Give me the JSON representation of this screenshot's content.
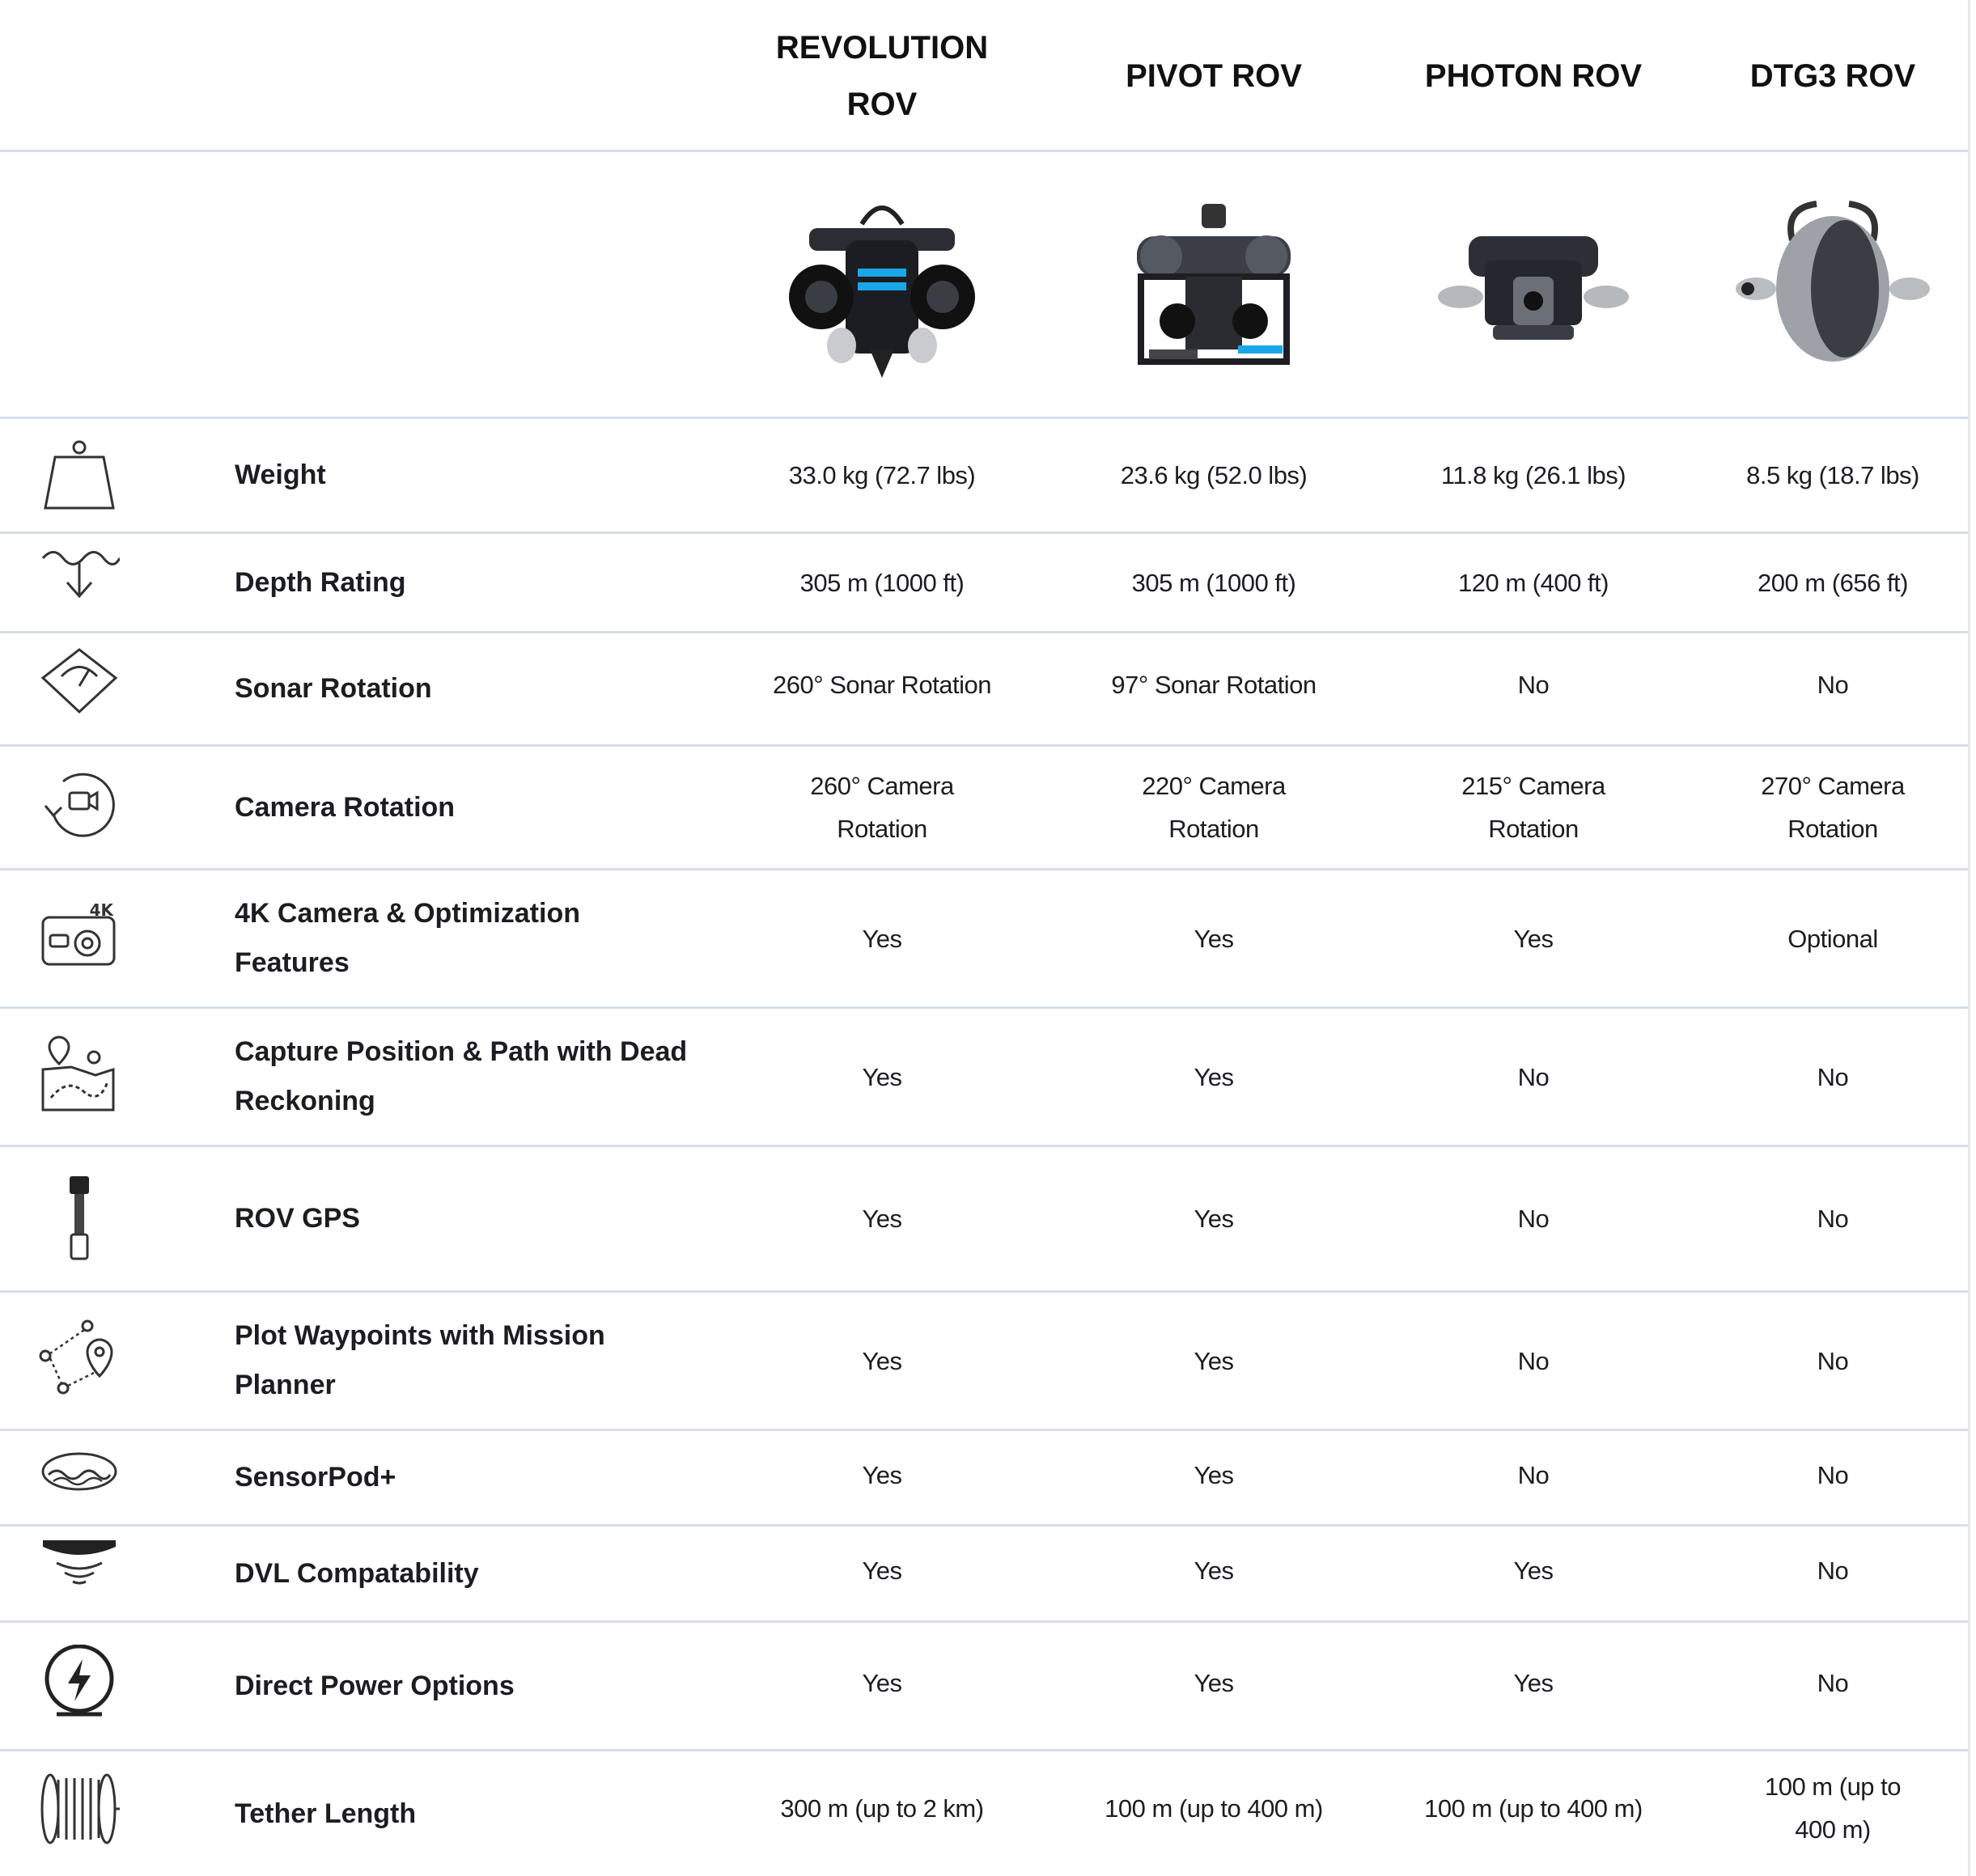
{
  "columns": [
    {
      "header": "REVOLUTION ROV",
      "image_alt": "revolution-rov"
    },
    {
      "header": "PIVOT ROV",
      "image_alt": "pivot-rov"
    },
    {
      "header": "PHOTON ROV",
      "image_alt": "photon-rov"
    },
    {
      "header": "DTG3 ROV",
      "image_alt": "dtg3-rov"
    }
  ],
  "rows": [
    {
      "label": "Weight",
      "icon": "weight-icon",
      "values": [
        "33.0 kg (72.7 lbs)",
        "23.6 kg (52.0 lbs)",
        "11.8 kg (26.1 lbs)",
        "8.5 kg (18.7 lbs)"
      ]
    },
    {
      "label": "Depth Rating",
      "icon": "depth-icon",
      "values": [
        "305 m (1000 ft)",
        "305 m (1000 ft)",
        "120 m (400 ft)",
        "200 m (656 ft)"
      ]
    },
    {
      "label": "Sonar Rotation",
      "icon": "sonar-icon",
      "values": [
        "260° Sonar Rotation",
        "97° Sonar Rotation",
        "No",
        "No"
      ]
    },
    {
      "label": "Camera Rotation",
      "icon": "camera-rotation-icon",
      "values": [
        "260° Camera Rotation",
        "220° Camera Rotation",
        "215° Camera Rotation",
        "270° Camera Rotation"
      ]
    },
    {
      "label": "4K Camera & Optimization Features",
      "icon": "4k-camera-icon",
      "icon_text": "4K",
      "values": [
        "Yes",
        "Yes",
        "Yes",
        "Optional"
      ]
    },
    {
      "label": "Capture Position & Path with Dead Reckoning",
      "icon": "map-path-icon",
      "values": [
        "Yes",
        "Yes",
        "No",
        "No"
      ]
    },
    {
      "label": "ROV GPS",
      "icon": "gps-antenna-icon",
      "values": [
        "Yes",
        "Yes",
        "No",
        "No"
      ]
    },
    {
      "label": "Plot Waypoints with Mission Planner",
      "icon": "waypoints-icon",
      "values": [
        "Yes",
        "Yes",
        "No",
        "No"
      ]
    },
    {
      "label": "SensorPod+",
      "icon": "sensorpod-icon",
      "values": [
        "Yes",
        "Yes",
        "No",
        "No"
      ]
    },
    {
      "label": "DVL Compatability",
      "icon": "dvl-icon",
      "values": [
        "Yes",
        "Yes",
        "Yes",
        "No"
      ]
    },
    {
      "label": "Direct Power Options",
      "icon": "power-icon",
      "values": [
        "Yes",
        "Yes",
        "Yes",
        "No"
      ]
    },
    {
      "label": "Tether Length",
      "icon": "tether-reel-icon",
      "values": [
        "300 m (up to 2 km)",
        "100 m (up to 400 m)",
        "100 m (up to 400 m)",
        "100 m (up to 400 m)"
      ]
    }
  ],
  "colors": {
    "divider": "#d6dee8",
    "text": "#1c1d22",
    "accent": "#1aa7e8"
  }
}
